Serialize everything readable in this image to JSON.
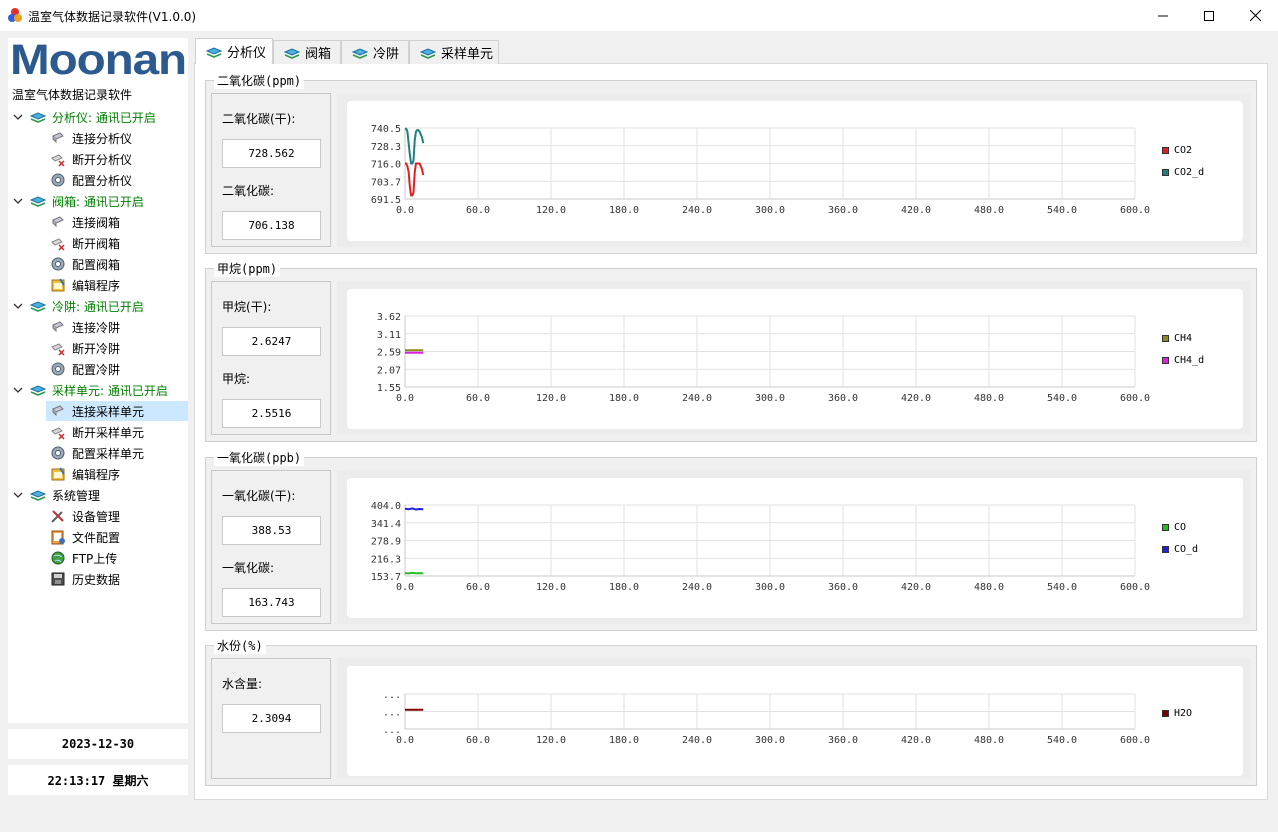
{
  "window": {
    "title": "温室气体数据记录软件(V1.0.0)"
  },
  "logo": {
    "text": "Moonan"
  },
  "tree": {
    "root": "温室气体数据记录软件",
    "groups": [
      {
        "label": "分析仪: 通讯已开启",
        "status": "connected",
        "items": [
          {
            "label": "连接分析仪",
            "icon": "connect-icon"
          },
          {
            "label": "断开分析仪",
            "icon": "disconnect-icon"
          },
          {
            "label": "配置分析仪",
            "icon": "gear-icon"
          }
        ]
      },
      {
        "label": "阀箱: 通讯已开启",
        "status": "connected",
        "items": [
          {
            "label": "连接阀箱",
            "icon": "connect-icon"
          },
          {
            "label": "断开阀箱",
            "icon": "disconnect-icon"
          },
          {
            "label": "配置阀箱",
            "icon": "gear-icon"
          },
          {
            "label": "编辑程序",
            "icon": "edit-program-icon"
          }
        ]
      },
      {
        "label": "冷阱: 通讯已开启",
        "status": "connected",
        "items": [
          {
            "label": "连接冷阱",
            "icon": "connect-icon"
          },
          {
            "label": "断开冷阱",
            "icon": "disconnect-icon"
          },
          {
            "label": "配置冷阱",
            "icon": "gear-icon"
          }
        ]
      },
      {
        "label": "采样单元: 通讯已开启",
        "status": "connected",
        "items": [
          {
            "label": "连接采样单元",
            "icon": "connect-icon",
            "selected": true
          },
          {
            "label": "断开采样单元",
            "icon": "disconnect-icon"
          },
          {
            "label": "配置采样单元",
            "icon": "gear-icon"
          },
          {
            "label": "编辑程序",
            "icon": "edit-program-icon"
          }
        ]
      },
      {
        "label": "系统管理",
        "status": "none",
        "items": [
          {
            "label": "设备管理",
            "icon": "tools-icon"
          },
          {
            "label": "文件配置",
            "icon": "file-config-icon"
          },
          {
            "label": "FTP上传",
            "icon": "globe-icon"
          },
          {
            "label": "历史数据",
            "icon": "disk-icon"
          }
        ]
      }
    ]
  },
  "datetime": {
    "date": "2023-12-30",
    "time": "22:13:17 星期六"
  },
  "tabs": [
    {
      "label": "分析仪",
      "active": true
    },
    {
      "label": "阀箱"
    },
    {
      "label": "冷阱"
    },
    {
      "label": "采样单元"
    }
  ],
  "panels": [
    {
      "title": "二氧化碳(ppm)",
      "values": [
        {
          "label": "二氧化碳(干):",
          "value": "728.562"
        },
        {
          "label": "二氧化碳:",
          "value": "706.138"
        }
      ]
    },
    {
      "title": "甲烷(ppm)",
      "values": [
        {
          "label": "甲烷(干):",
          "value": "2.6247"
        },
        {
          "label": "甲烷:",
          "value": "2.5516"
        }
      ]
    },
    {
      "title": "一氧化碳(ppb)",
      "values": [
        {
          "label": "一氧化碳(干):",
          "value": "388.53"
        },
        {
          "label": "一氧化碳:",
          "value": "163.743"
        }
      ]
    },
    {
      "title": "水份(%)",
      "values": [
        {
          "label": "水含量:",
          "value": "2.3094"
        }
      ]
    }
  ],
  "chart_data": [
    {
      "type": "line",
      "title": "二氧化碳(ppm)",
      "xticks": [
        "0.0",
        "60.0",
        "120.0",
        "180.0",
        "240.0",
        "300.0",
        "360.0",
        "420.0",
        "480.0",
        "540.0",
        "600.0"
      ],
      "yticks": [
        "740.5",
        "728.3",
        "716.0",
        "703.7",
        "691.5"
      ],
      "xlim": [
        0,
        600
      ],
      "ylim": [
        691.5,
        740.5
      ],
      "series": [
        {
          "name": "CO2",
          "color": "#e02020",
          "x": [
            0,
            1,
            2,
            3,
            4,
            5,
            6,
            7,
            8,
            9,
            10,
            11,
            12,
            13,
            14,
            15
          ],
          "y": [
            716,
            716,
            714,
            710,
            700,
            694,
            694,
            696,
            710,
            716,
            716,
            716,
            716,
            714,
            712,
            708
          ]
        },
        {
          "name": "CO2_d",
          "color": "#208080",
          "x": [
            0,
            1,
            2,
            3,
            4,
            5,
            6,
            7,
            8,
            9,
            10,
            11,
            12,
            13,
            14,
            15
          ],
          "y": [
            740,
            740,
            738,
            730,
            722,
            716,
            716,
            718,
            732,
            738,
            739,
            739,
            738,
            736,
            734,
            730
          ]
        }
      ]
    },
    {
      "type": "line",
      "title": "甲烷(ppm)",
      "xticks": [
        "0.0",
        "60.0",
        "120.0",
        "180.0",
        "240.0",
        "300.0",
        "360.0",
        "420.0",
        "480.0",
        "540.0",
        "600.0"
      ],
      "yticks": [
        "3.62",
        "3.11",
        "2.59",
        "2.07",
        "1.55"
      ],
      "xlim": [
        0,
        600
      ],
      "ylim": [
        1.55,
        3.62
      ],
      "series": [
        {
          "name": "CH4",
          "color": "#8a8a20",
          "x": [
            0,
            5,
            10,
            15
          ],
          "y": [
            2.62,
            2.62,
            2.62,
            2.62
          ]
        },
        {
          "name": "CH4_d",
          "color": "#e020e0",
          "x": [
            0,
            5,
            10,
            15
          ],
          "y": [
            2.55,
            2.55,
            2.55,
            2.55
          ]
        }
      ]
    },
    {
      "type": "line",
      "title": "一氧化碳(ppb)",
      "xticks": [
        "0.0",
        "60.0",
        "120.0",
        "180.0",
        "240.0",
        "300.0",
        "360.0",
        "420.0",
        "480.0",
        "540.0",
        "600.0"
      ],
      "yticks": [
        "404.0",
        "341.4",
        "278.9",
        "216.3",
        "153.7"
      ],
      "xlim": [
        0,
        600
      ],
      "ylim": [
        153.7,
        404.0
      ],
      "series": [
        {
          "name": "CO",
          "color": "#20c020",
          "x": [
            0,
            3,
            6,
            9,
            12,
            15
          ],
          "y": [
            164,
            163,
            165,
            163,
            164,
            163
          ]
        },
        {
          "name": "CO_d",
          "color": "#2020e0",
          "x": [
            0,
            3,
            6,
            9,
            12,
            15
          ],
          "y": [
            391,
            389,
            392,
            388,
            390,
            389
          ]
        }
      ]
    },
    {
      "type": "line",
      "title": "水份(%)",
      "xticks": [
        "0.0",
        "60.0",
        "120.0",
        "180.0",
        "240.0",
        "300.0",
        "360.0",
        "420.0",
        "480.0",
        "540.0",
        "600.0"
      ],
      "yticks": [
        "...",
        "...",
        "..."
      ],
      "xlim": [
        0,
        600
      ],
      "ylim": [
        2.2,
        2.4
      ],
      "series": [
        {
          "name": "H2O",
          "color": "#800000",
          "x": [
            0,
            5,
            10,
            15
          ],
          "y": [
            2.31,
            2.31,
            2.31,
            2.31
          ]
        }
      ]
    }
  ]
}
